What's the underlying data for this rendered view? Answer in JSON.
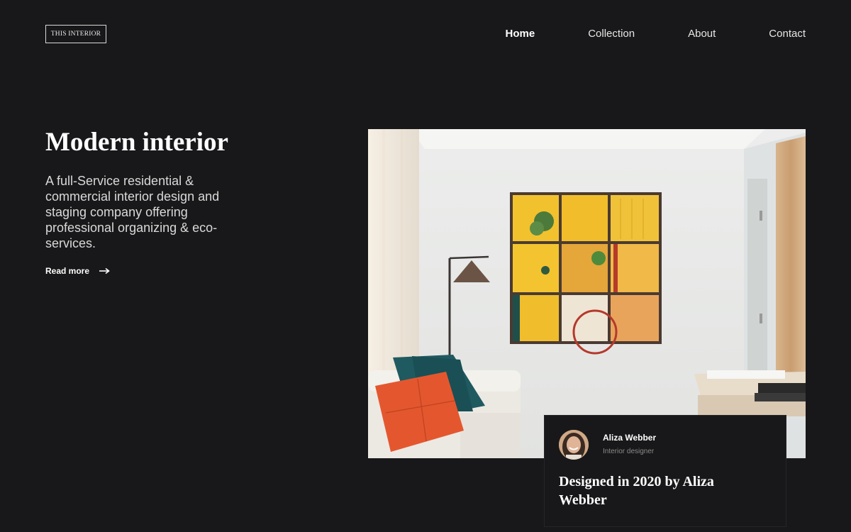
{
  "brand": {
    "logo_text": "THIS INTERIOR"
  },
  "nav": {
    "items": [
      {
        "label": "Home",
        "active": true
      },
      {
        "label": "Collection",
        "active": false
      },
      {
        "label": "About",
        "active": false
      },
      {
        "label": "Contact",
        "active": false
      }
    ]
  },
  "hero": {
    "title": "Modern interior",
    "description": "A full-Service residential & commercial interior design and staging company offering professional organizing & eco-services.",
    "read_more": "Read more",
    "read_more_icon": "arrow-right-icon"
  },
  "card": {
    "name": "Aliza Webber",
    "role": "Interior designer",
    "text": "Designed in 2020 by Aliza Webber"
  },
  "colors": {
    "background": "#18181a",
    "text": "#ffffff",
    "muted": "#8a8a8a"
  }
}
